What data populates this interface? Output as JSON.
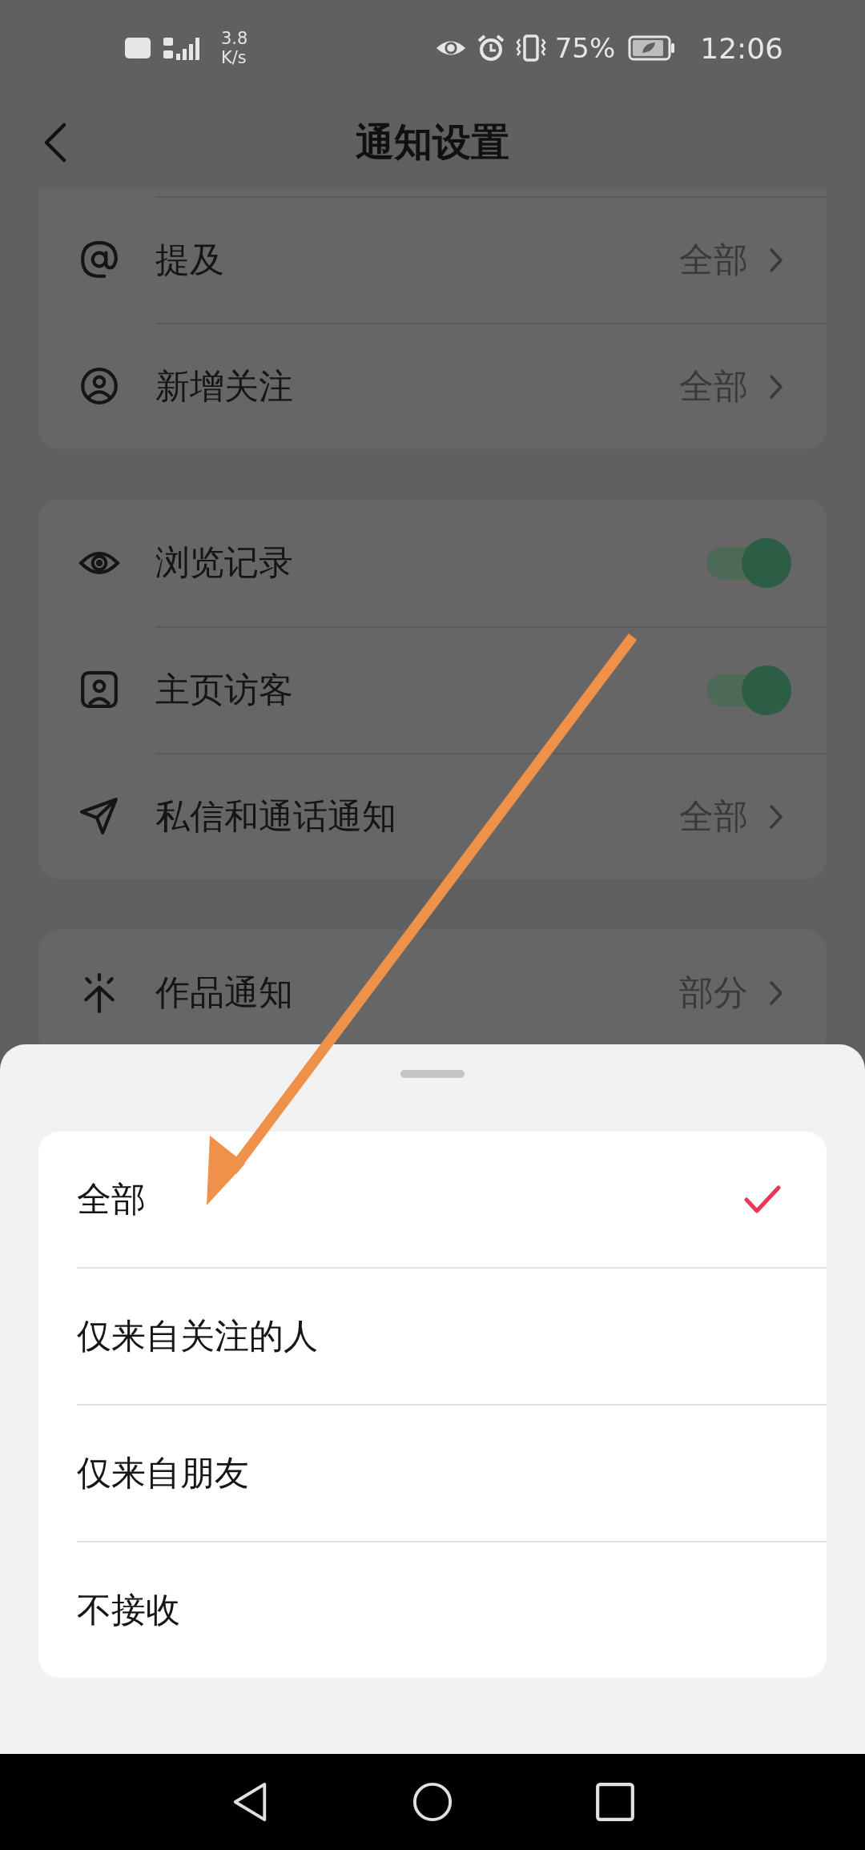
{
  "status_bar": {
    "speed": "3.8",
    "speed_unit": "K/s",
    "battery": "75%",
    "time": "12:06"
  },
  "header": {
    "title": "通知设置"
  },
  "groups": [
    {
      "rows": [
        {
          "kind": "choice",
          "label": "提及",
          "value": "全部"
        },
        {
          "kind": "choice",
          "label": "新增关注",
          "value": "全部"
        }
      ]
    },
    {
      "rows": [
        {
          "kind": "toggle",
          "label": "浏览记录",
          "on": true
        },
        {
          "kind": "toggle",
          "label": "主页访客",
          "on": true
        },
        {
          "kind": "choice",
          "label": "私信和通话通知",
          "value": "全部"
        }
      ]
    },
    {
      "rows": [
        {
          "kind": "choice",
          "label": "作品通知",
          "value": "部分"
        }
      ]
    }
  ],
  "sheet": {
    "options": [
      {
        "label": "全部",
        "selected": true
      },
      {
        "label": "仅来自关注的人",
        "selected": false
      },
      {
        "label": "仅来自朋友",
        "selected": false
      },
      {
        "label": "不接收",
        "selected": false
      }
    ]
  }
}
